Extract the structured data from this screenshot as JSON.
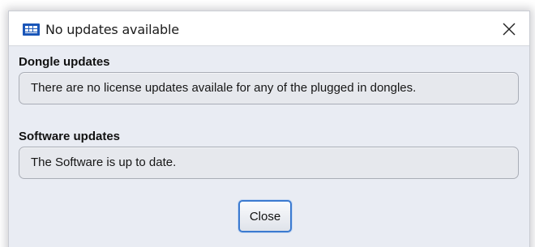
{
  "window": {
    "title": "No updates available",
    "app_icon": "application-icon",
    "close_icon": "close-icon"
  },
  "sections": {
    "dongle": {
      "heading": "Dongle updates",
      "message": "There are no license updates availale for any of the plugged in dongles."
    },
    "software": {
      "heading": "Software updates",
      "message": "The Software is up to date."
    }
  },
  "actions": {
    "close_label": "Close"
  },
  "colors": {
    "accent": "#3b7ad0",
    "app_icon_bg": "#1a56b8",
    "dialog_bg": "#e9ecf3"
  }
}
